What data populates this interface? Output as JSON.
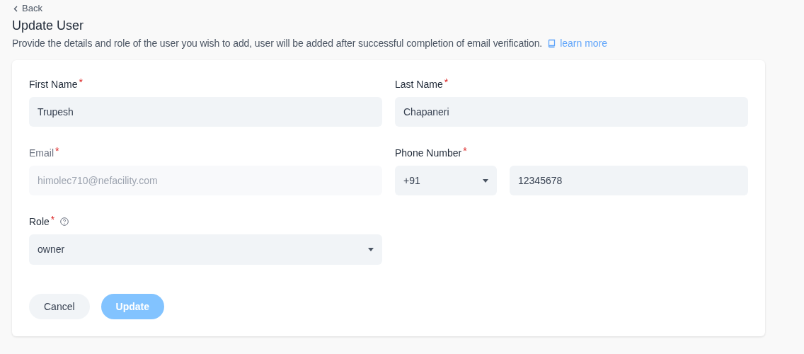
{
  "back": {
    "label": "Back"
  },
  "title": "Update User",
  "description": "Provide the details and role of the user you wish to add, user will be added after successful completion of email verification.",
  "learn_more": "learn more",
  "fields": [
    {
      "kind": "text",
      "label": "First Name",
      "required_mark": "*",
      "value": "Trupesh",
      "disabled": false
    },
    {
      "kind": "text",
      "label": "Last Name",
      "required_mark": "*",
      "value": "Chapaneri",
      "disabled": false
    },
    {
      "kind": "text",
      "label": "Email",
      "required_mark": "*",
      "value": "himolec710@nefacility.com",
      "disabled": true
    },
    {
      "kind": "phone",
      "label": "Phone Number",
      "required_mark": "*",
      "code": "+91",
      "value": "12345678",
      "disabled": false
    },
    {
      "kind": "select",
      "label": "Role",
      "required_mark": "*",
      "help": true,
      "value": "owner",
      "disabled": false
    }
  ],
  "buttons": [
    {
      "kind": "secondary",
      "label": "Cancel",
      "disabled": false
    },
    {
      "kind": "primary",
      "label": "Update",
      "disabled": true
    }
  ]
}
